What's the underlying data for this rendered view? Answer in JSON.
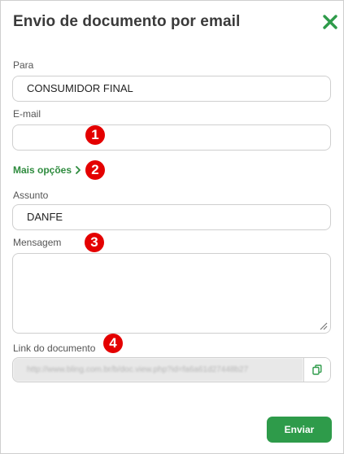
{
  "dialog": {
    "title": "Envio de documento por email",
    "close_icon": "close-x-icon",
    "close_color": "#2e9b4a"
  },
  "form": {
    "to_label": "Para",
    "to_value": "CONSUMIDOR FINAL",
    "email_label": "E-mail",
    "email_value": "",
    "more_options_label": "Mais opções",
    "more_options_icon": "chevron-right-icon",
    "subject_label": "Assunto",
    "subject_value": "DANFE",
    "message_label": "Mensagem",
    "message_value": "",
    "doc_link_label": "Link do documento",
    "doc_link_value": "http://www.bling.com.br/b/doc.view.php?id=fa6a61d27448b27",
    "copy_icon": "copy-icon",
    "send_label": "Enviar"
  },
  "annotations": {
    "badge_1": "1",
    "badge_2": "2",
    "badge_3": "3",
    "badge_4": "4"
  },
  "colors": {
    "accent_green": "#2e9b4a",
    "badge_red": "#e40000"
  }
}
